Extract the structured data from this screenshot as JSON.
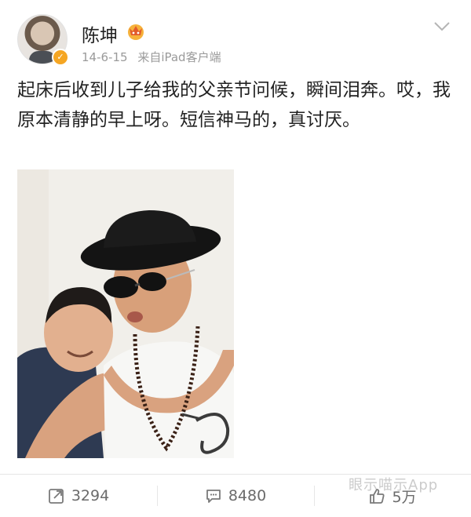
{
  "user": {
    "name": "陈坤",
    "timestamp": "14-6-15",
    "source": "来自iPad客户端"
  },
  "post": {
    "text": "起床后收到儿子给我的父亲节问候，瞬间泪奔。哎，我原本清静的早上呀。短信神马的，真讨厌。"
  },
  "actions": {
    "repost_count": "3294",
    "comment_count": "8480",
    "like_count": "5万"
  },
  "watermark": "眼示喵示App",
  "colors": {
    "verified_badge": "#f5a623",
    "meta_text": "#9a9a9a",
    "action_text": "#6b6b6b"
  },
  "icons": {
    "verified": "verified-badge-icon",
    "vip": "vip-crown-icon",
    "menu": "chevron-down-icon",
    "repost": "repost-icon",
    "comment": "comment-icon",
    "like": "thumbs-up-icon"
  }
}
